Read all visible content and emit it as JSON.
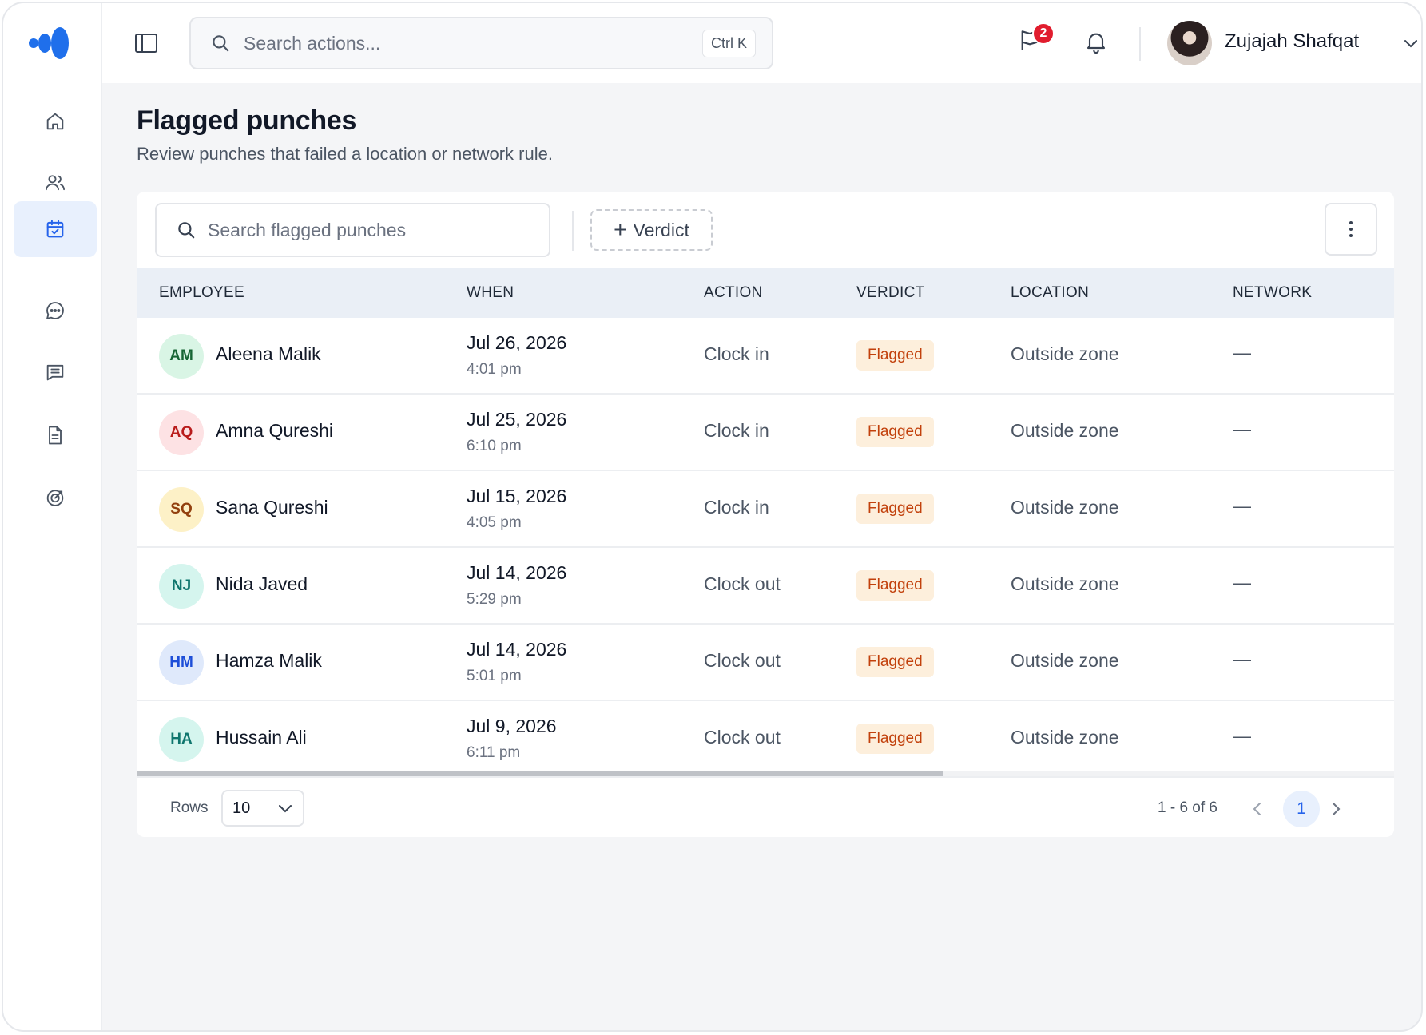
{
  "topbar": {
    "search_placeholder": "Search actions...",
    "search_shortcut": "Ctrl K",
    "notification_count": "2",
    "user_name": "Zujajah Shafqat"
  },
  "sidebar": {
    "items": [
      {
        "icon": "home-icon",
        "active": false
      },
      {
        "icon": "users-icon",
        "active": false
      },
      {
        "icon": "calendar-check-icon",
        "active": true
      },
      {
        "icon": "chat-icon",
        "active": false
      },
      {
        "icon": "message-list-icon",
        "active": false
      },
      {
        "icon": "document-icon",
        "active": false
      },
      {
        "icon": "target-icon",
        "active": false
      }
    ]
  },
  "page": {
    "title": "Flagged punches",
    "subtitle": "Review punches that failed a location or network rule."
  },
  "toolbar": {
    "search_placeholder": "Search flagged punches",
    "verdict_label": "Verdict"
  },
  "table": {
    "columns": [
      "EMPLOYEE",
      "WHEN",
      "ACTION",
      "VERDICT",
      "LOCATION",
      "NETWORK"
    ],
    "rows": [
      {
        "initials": "AM",
        "name": "Aleena Malik",
        "date": "Jul 26, 2026",
        "time": "4:01 pm",
        "action": "Clock in",
        "verdict": "Flagged",
        "location": "Outside zone",
        "network": "—",
        "avatar_bg": "#d9f5e5",
        "avatar_fg": "#166534"
      },
      {
        "initials": "AQ",
        "name": "Amna Qureshi",
        "date": "Jul 25, 2026",
        "time": "6:10 pm",
        "action": "Clock in",
        "verdict": "Flagged",
        "location": "Outside zone",
        "network": "—",
        "avatar_bg": "#fde2e4",
        "avatar_fg": "#b91c1c"
      },
      {
        "initials": "SQ",
        "name": "Sana Qureshi",
        "date": "Jul 15, 2026",
        "time": "4:05 pm",
        "action": "Clock in",
        "verdict": "Flagged",
        "location": "Outside zone",
        "network": "—",
        "avatar_bg": "#fdf1c7",
        "avatar_fg": "#92400e"
      },
      {
        "initials": "NJ",
        "name": "Nida Javed",
        "date": "Jul 14, 2026",
        "time": "5:29 pm",
        "action": "Clock out",
        "verdict": "Flagged",
        "location": "Outside zone",
        "network": "—",
        "avatar_bg": "#d5f5ee",
        "avatar_fg": "#0f766e"
      },
      {
        "initials": "HM",
        "name": "Hamza Malik",
        "date": "Jul 14, 2026",
        "time": "5:01 pm",
        "action": "Clock out",
        "verdict": "Flagged",
        "location": "Outside zone",
        "network": "—",
        "avatar_bg": "#dfe9fb",
        "avatar_fg": "#1d4ed8"
      },
      {
        "initials": "HA",
        "name": "Hussain Ali",
        "date": "Jul 9, 2026",
        "time": "6:11 pm",
        "action": "Clock out",
        "verdict": "Flagged",
        "location": "Outside zone",
        "network": "—",
        "avatar_bg": "#d5f5ee",
        "avatar_fg": "#0f766e"
      }
    ]
  },
  "footer": {
    "rows_label": "Rows",
    "rows_value": "10",
    "range": "1 - 6 of 6",
    "page": "1"
  },
  "colors": {
    "accent": "#2563eb",
    "flagged_bg": "#fdefdc",
    "flagged_fg": "#c2410c",
    "badge": "#e11d2e"
  }
}
